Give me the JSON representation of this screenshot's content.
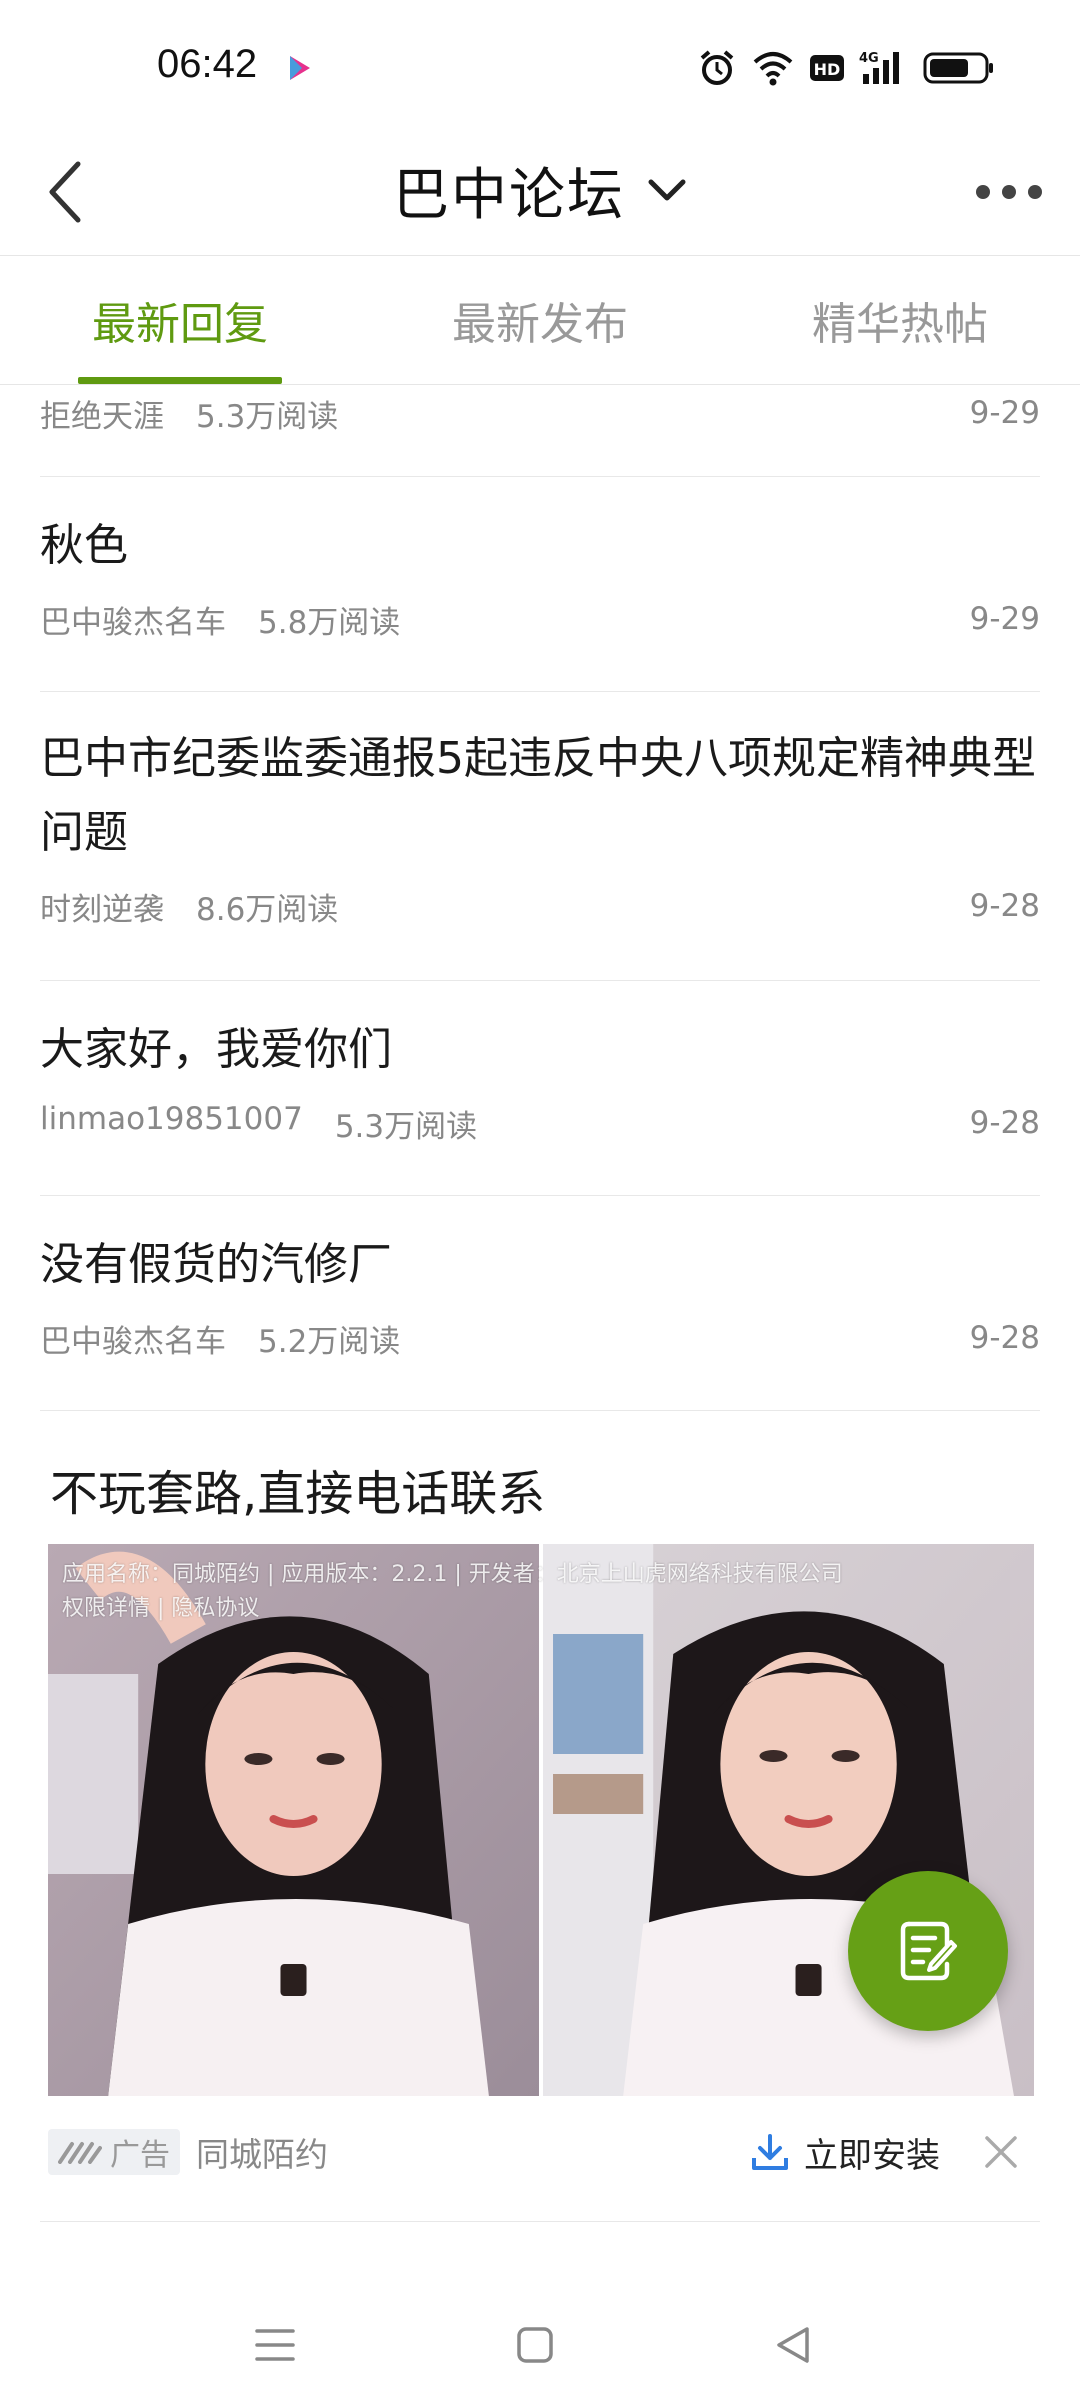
{
  "status_bar": {
    "time": "06:42",
    "app_icon": "youku-icon",
    "icons": [
      "alarm-icon",
      "wifi-icon",
      "hd-icon",
      "signal-4g-icon",
      "battery-icon"
    ],
    "network_label": "4G",
    "hd_label": "HD"
  },
  "header": {
    "title": "巴中论坛",
    "back_icon": "back-chevron-icon",
    "dropdown_icon": "chevron-down-icon",
    "more_icon": "more-dots-icon"
  },
  "tabs": [
    {
      "label": "最新回复",
      "active": true
    },
    {
      "label": "最新发布",
      "active": false
    },
    {
      "label": "精华热帖",
      "active": false
    }
  ],
  "posts": [
    {
      "title": "",
      "author": "拒绝天涯",
      "reads": "5.3万阅读",
      "date": "9-29"
    },
    {
      "title": "秋色",
      "author": "巴中骏杰名车",
      "reads": "5.8万阅读",
      "date": "9-29"
    },
    {
      "title": "巴中市纪委监委通报5起违反中央八项规定精神典型问题",
      "author": "时刻逆袭",
      "reads": "8.6万阅读",
      "date": "9-28"
    },
    {
      "title": "大家好，我爱你们",
      "author": "linmao19851007",
      "reads": "5.3万阅读",
      "date": "9-28"
    },
    {
      "title": "没有假货的汽修厂",
      "author": "巴中骏杰名车",
      "reads": "5.2万阅读",
      "date": "9-28"
    }
  ],
  "ad": {
    "title": "不玩套路,直接电话联系",
    "info_line1": "应用名称：同城陌约 | 应用版本：2.2.1 | 开发者：北京上山虎网络科技有限公司",
    "info_line2": "权限详情 | 隐私协议",
    "badge": "广告",
    "source": "同城陌约",
    "install_label": "立即安装",
    "close_icon": "close-icon",
    "download_icon": "download-icon"
  },
  "fab": {
    "icon": "compose-icon"
  },
  "nav": {
    "icons": [
      "menu-icon",
      "home-square-icon",
      "back-triangle-icon"
    ]
  },
  "colors": {
    "accent": "#5f9a10",
    "fab": "#66a016",
    "muted": "#888888"
  }
}
